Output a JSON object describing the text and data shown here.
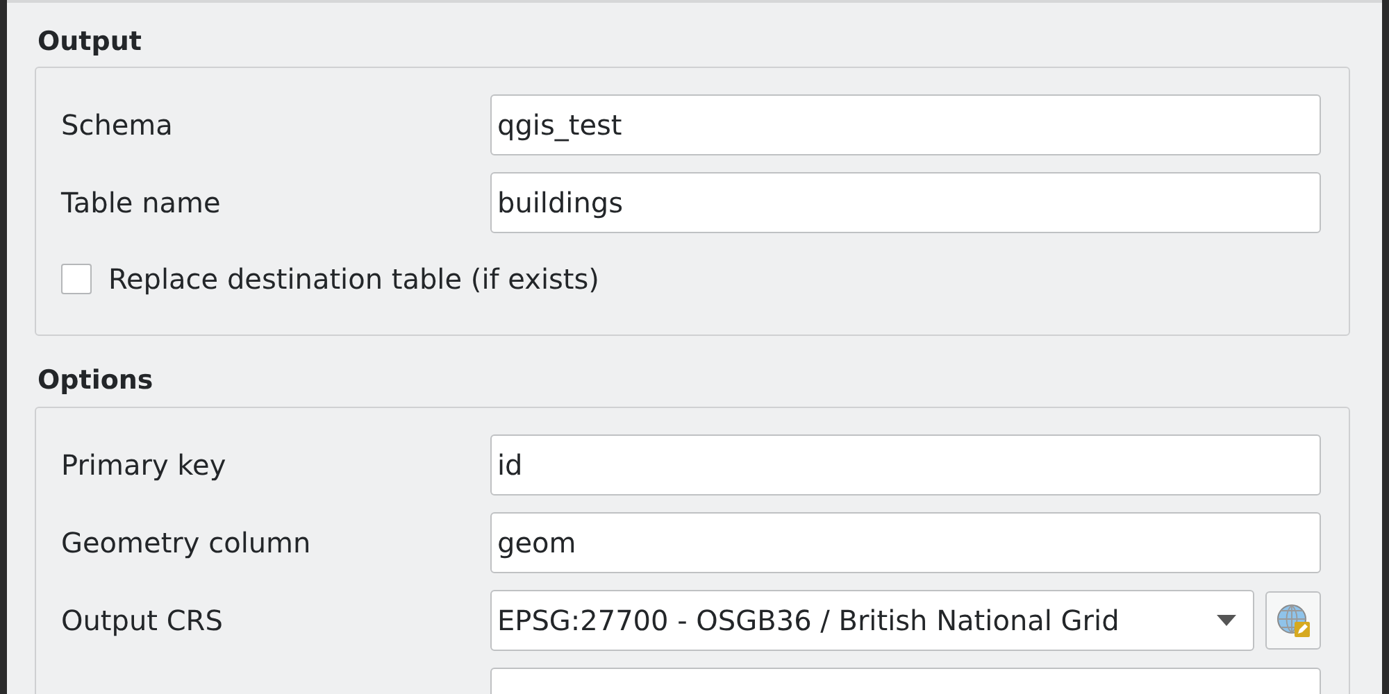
{
  "sections": [
    {
      "title": "Output",
      "rows": [
        {
          "kind": "text",
          "label": "Schema",
          "value": "qgis_test"
        },
        {
          "kind": "text",
          "label": "Table name",
          "value": "buildings"
        },
        {
          "kind": "checkbox",
          "label": "Replace destination table (if exists)",
          "checked": false
        }
      ]
    },
    {
      "title": "Options",
      "rows": [
        {
          "kind": "text",
          "label": "Primary key",
          "value": "id"
        },
        {
          "kind": "text",
          "label": "Geometry column",
          "value": "geom"
        },
        {
          "kind": "combo",
          "label": "Output CRS",
          "value": "EPSG:27700 - OSGB36 / British National Grid"
        },
        {
          "kind": "text"
        }
      ]
    }
  ]
}
